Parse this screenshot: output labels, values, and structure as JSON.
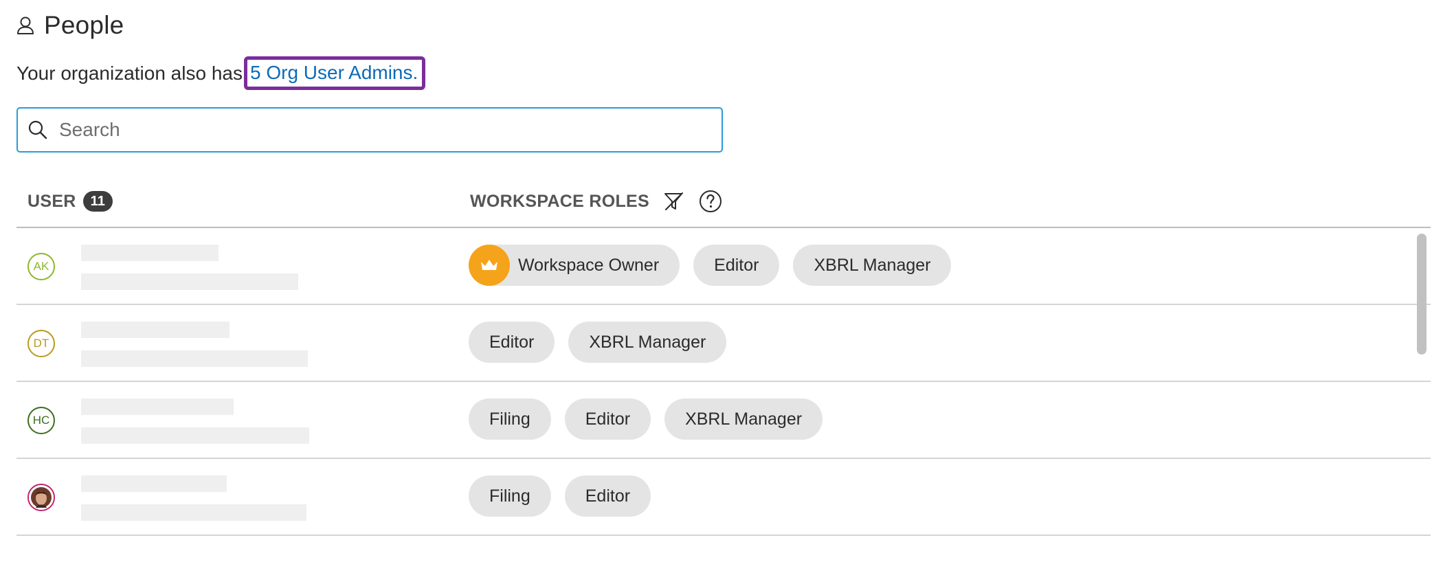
{
  "header": {
    "title": "People",
    "icon": "person-icon"
  },
  "subtitle": {
    "text": "Your organization also has",
    "link": "5 Org User Admins."
  },
  "search": {
    "placeholder": "Search",
    "value": ""
  },
  "table": {
    "user_label": "USER",
    "user_count": "11",
    "roles_label": "WORKSPACE ROLES"
  },
  "rows": [
    {
      "initials": "AK",
      "avatar_color": "#8cb82a",
      "roles": [
        "Workspace Owner",
        "Editor",
        "XBRL Manager"
      ],
      "owner": true
    },
    {
      "initials": "DT",
      "avatar_color": "#b89a1c",
      "roles": [
        "Editor",
        "XBRL Manager"
      ],
      "owner": false
    },
    {
      "initials": "HC",
      "avatar_color": "#3c6e1e",
      "roles": [
        "Filing",
        "Editor",
        "XBRL Manager"
      ],
      "owner": false
    },
    {
      "initials": "",
      "avatar_color": "#c0206a",
      "roles": [
        "Filing",
        "Editor"
      ],
      "owner": false
    }
  ],
  "colors": {
    "link": "#0d6ab8",
    "focus_outline": "#7a2e9a",
    "search_border": "#2a9bd6",
    "chip_bg": "#e4e4e4",
    "crown_bg": "#f5a31a"
  }
}
